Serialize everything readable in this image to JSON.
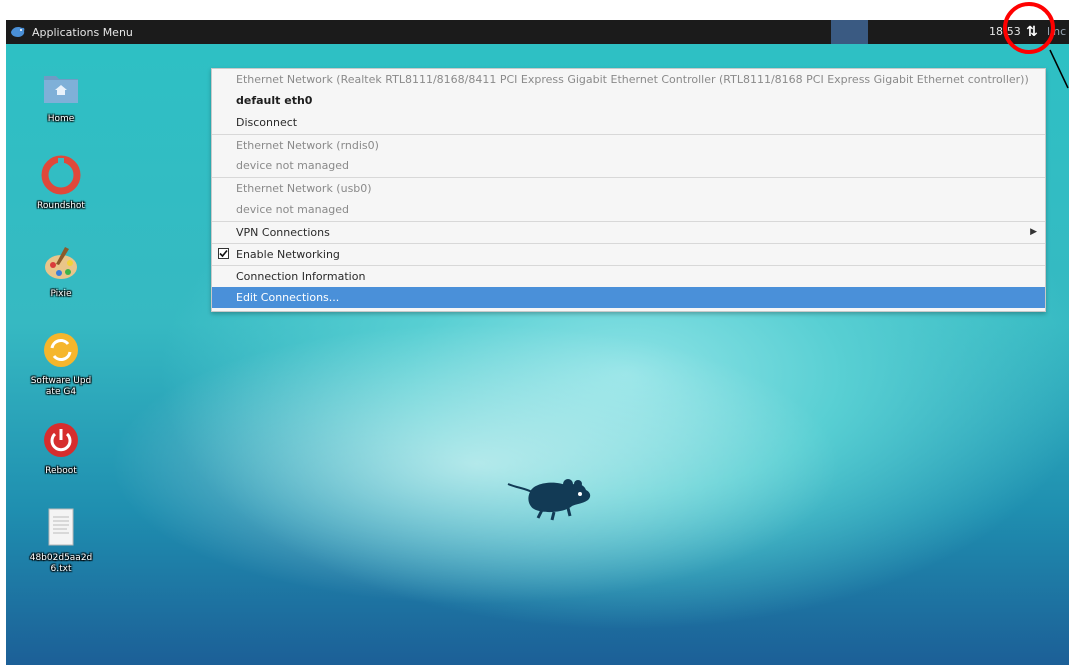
{
  "panel": {
    "apps_menu_label": "Applications Menu",
    "clock": "18:53",
    "user": "linc",
    "net_icon": "network-updown-icon"
  },
  "desktop": {
    "icons": [
      {
        "label": "Home",
        "icon": "home-folder-icon"
      },
      {
        "label": "Roundshot",
        "icon": "roundshot-icon"
      },
      {
        "label": "Pixie",
        "icon": "palette-icon"
      },
      {
        "label": "Software Update G4",
        "icon": "software-update-icon"
      },
      {
        "label": "Reboot",
        "icon": "power-icon"
      },
      {
        "label": "48b02d5aa2d6.txt",
        "icon": "text-file-icon"
      }
    ]
  },
  "network_menu": {
    "items": [
      {
        "label": "Ethernet Network (Realtek RTL8111/8168/8411 PCI Express Gigabit Ethernet Controller (RTL8111/8168 PCI Express Gigabit Ethernet controller))",
        "style": "dim"
      },
      {
        "label": "default eth0",
        "style": "bold"
      },
      {
        "label": "Disconnect",
        "style": "normal"
      },
      {
        "label": "Ethernet Network (rndis0)",
        "style": "dim"
      },
      {
        "label": "device not managed",
        "style": "dim"
      },
      {
        "label": "Ethernet Network (usb0)",
        "style": "dim"
      },
      {
        "label": "device not managed",
        "style": "dim"
      },
      {
        "label": "VPN Connections",
        "style": "normal"
      },
      {
        "label": "Enable Networking",
        "style": "normal",
        "checked": true
      },
      {
        "label": "Connection Information",
        "style": "normal"
      },
      {
        "label": "Edit Connections...",
        "style": "selected"
      }
    ]
  },
  "colors": {
    "annotation": "#ff0000",
    "selection": "#4a90d9",
    "panel": "#1b1b1b"
  }
}
